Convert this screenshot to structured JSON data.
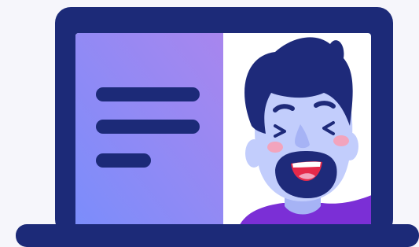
{
  "illustration": {
    "subject": "laptop-video-call",
    "icons": {
      "laptop": "laptop-icon",
      "document": "document-lines-icon",
      "person": "smiling-man-avatar"
    }
  },
  "colors": {
    "background": "#f6f6fb",
    "laptop_frame": "#1c2a78",
    "panel_gradient_start": "#7b8dfb",
    "panel_gradient_end": "#a886ee",
    "video_background": "#ffffff",
    "skin": "#c2cdfc",
    "skin_shadow": "#a6b3f5",
    "hair": "#1e2a7a",
    "cheek": "#f2a4bd",
    "mouth": "#e6294a",
    "shirt": "#7b2fd6"
  }
}
